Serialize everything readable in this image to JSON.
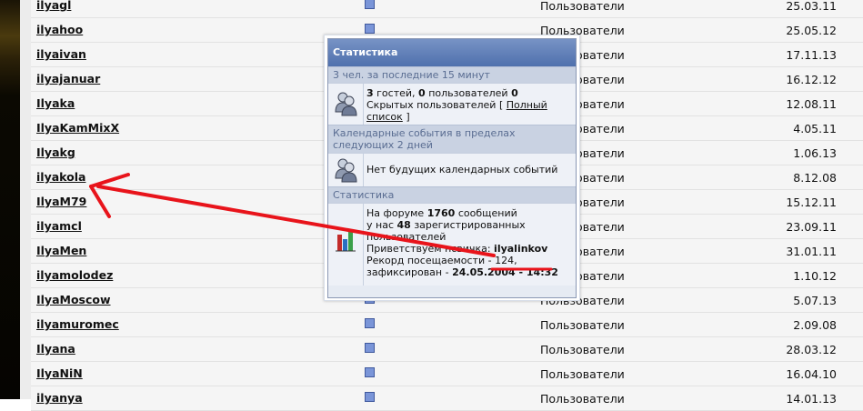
{
  "members": [
    {
      "name": "ilyagl",
      "group": "Пользователи",
      "joined": "25.03.11"
    },
    {
      "name": "ilyahoo",
      "group": "Пользователи",
      "joined": "25.05.12"
    },
    {
      "name": "ilyaivan",
      "group": "Пользователи",
      "joined": "17.11.13"
    },
    {
      "name": "ilyajanuar",
      "group": "Пользователи",
      "joined": "16.12.12"
    },
    {
      "name": "Ilyaka",
      "group": "Пользователи",
      "joined": "12.08.11"
    },
    {
      "name": "IlyaKamMixX",
      "group": "Пользователи",
      "joined": "4.05.11"
    },
    {
      "name": "Ilyakg",
      "group": "Пользователи",
      "joined": "1.06.13"
    },
    {
      "name": "ilyakola",
      "group": "Пользователи",
      "joined": "8.12.08"
    },
    {
      "name": "IlyaM79",
      "group": "Пользователи",
      "joined": "15.12.11"
    },
    {
      "name": "ilyamcl",
      "group": "Пользователи",
      "joined": "23.09.11"
    },
    {
      "name": "IlyaMen",
      "group": "Пользователи",
      "joined": "31.01.11"
    },
    {
      "name": "ilyamolodez",
      "group": "Пользователи",
      "joined": "1.10.12"
    },
    {
      "name": "IlyaMoscow",
      "group": "Пользователи",
      "joined": "5.07.13"
    },
    {
      "name": "ilyamuromec",
      "group": "Пользователи",
      "joined": "2.09.08"
    },
    {
      "name": "Ilyana",
      "group": "Пользователи",
      "joined": "28.03.12"
    },
    {
      "name": "IlyaNiN",
      "group": "Пользователи",
      "joined": "16.04.10"
    },
    {
      "name": "ilyanya",
      "group": "Пользователи",
      "joined": "14.01.13"
    }
  ],
  "stats": {
    "title": "Статистика",
    "online": {
      "title": "3 чел. за последние 15 минут",
      "guests_count": "3",
      "guests_word": "гостей,",
      "users_count": "0",
      "users_word": "пользователей",
      "hidden_count": "0",
      "hidden_label": "Скрытых пользователей [",
      "full_list_link": "Полный список",
      "bracket_close": "]"
    },
    "calendar": {
      "title": "Календарные события в пределах следующих 2 дней",
      "text": "Нет будущих календарных событий"
    },
    "board": {
      "title": "Статистика",
      "posts_prefix": "На форуме",
      "posts_count": "1760",
      "posts_suffix": "сообщений",
      "reg_prefix": "у нас",
      "reg_count": "48",
      "reg_suffix": "зарегистрированных пользователей",
      "welcome_prefix": "Приветствуем нсвичка:",
      "newest_member": "ilyalinkov",
      "record_prefix": "Рекорд посещаемости -",
      "record_count": "124,",
      "record_fixed": "зафиксирован -",
      "record_date": "24.05.2004 - 14:32"
    }
  },
  "annotation": {
    "color": "#e8141b"
  },
  "colors": {
    "member_link": "#111111",
    "stats_header": "#4f70ad",
    "stats_section": "#c9d2e2"
  }
}
